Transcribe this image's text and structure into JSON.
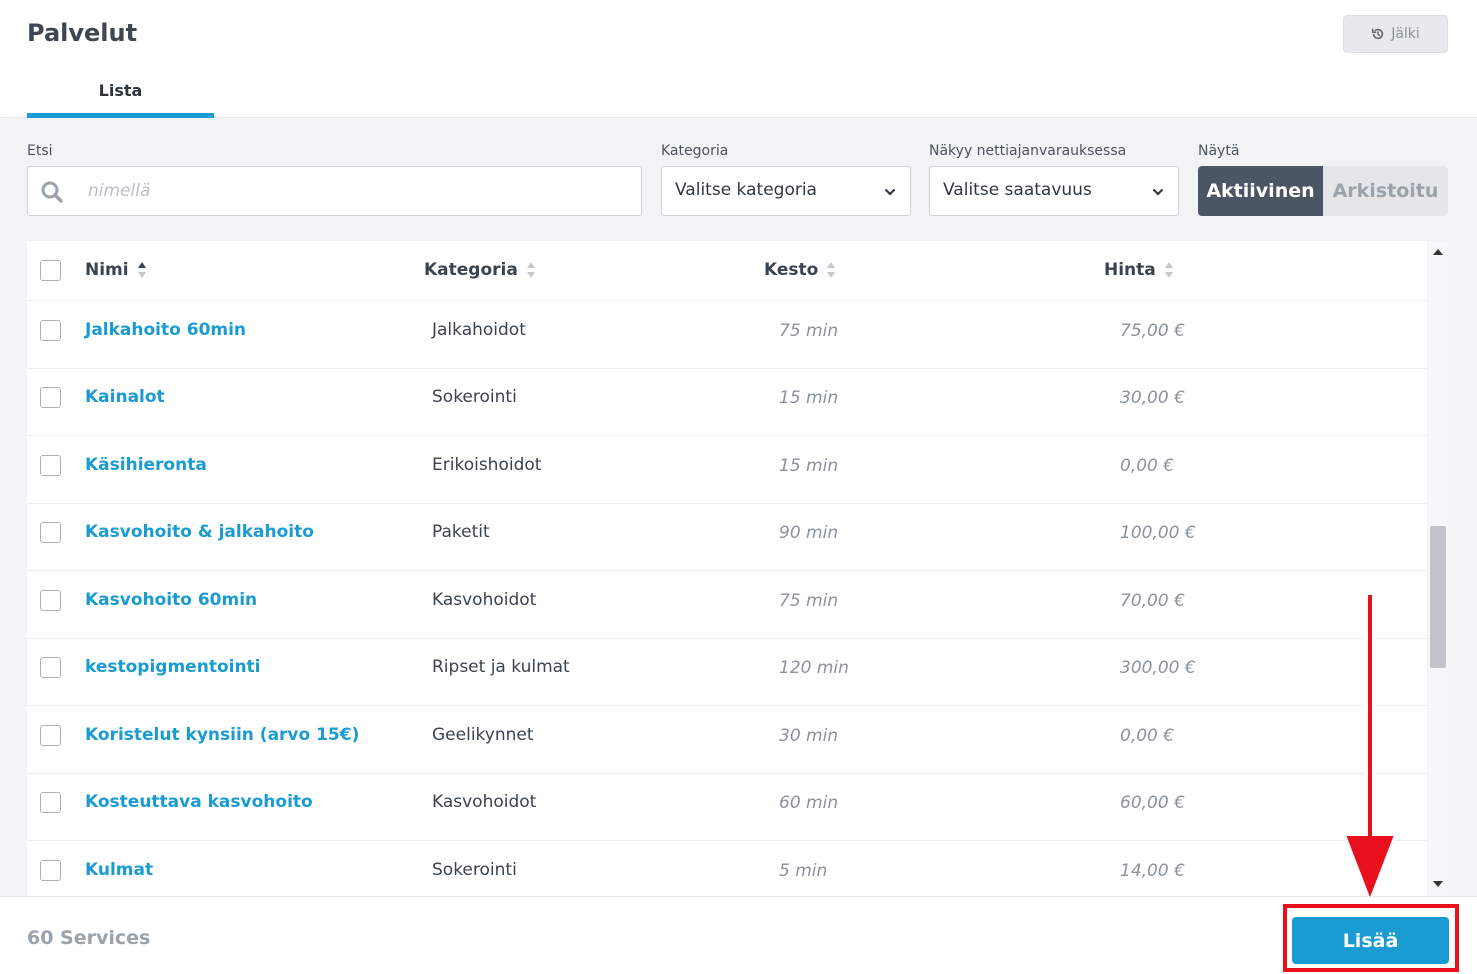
{
  "header": {
    "title": "Palvelut",
    "history_label": "Jälki",
    "tab_label": "Lista"
  },
  "filters": {
    "search_label": "Etsi",
    "search_placeholder": "nimellä",
    "category_label": "Kategoria",
    "category_value": "Valitse kategoria",
    "availability_label": "Näkyy nettiajanvarauksessa",
    "availability_value": "Valitse saatavuus",
    "show_label": "Näytä",
    "show_active": "Aktiivinen",
    "show_archived": "Arkistoitu"
  },
  "table": {
    "columns": [
      "Nimi",
      "Kategoria",
      "Kesto",
      "Hinta"
    ],
    "rows": [
      {
        "name": "Jalkahoito 60min",
        "category": "Jalkahoidot",
        "duration": "75 min",
        "price": "75,00 €"
      },
      {
        "name": "Kainalot",
        "category": "Sokerointi",
        "duration": "15 min",
        "price": "30,00 €"
      },
      {
        "name": "Käsihieronta",
        "category": "Erikoishoidot",
        "duration": "15 min",
        "price": "0,00 €"
      },
      {
        "name": "Kasvohoito & jalkahoito",
        "category": "Paketit",
        "duration": "90 min",
        "price": "100,00 €"
      },
      {
        "name": "Kasvohoito 60min",
        "category": "Kasvohoidot",
        "duration": "75 min",
        "price": "70,00 €"
      },
      {
        "name": "kestopigmentointi",
        "category": "Ripset ja kulmat",
        "duration": "120 min",
        "price": "300,00 €"
      },
      {
        "name": "Koristelut kynsiin (arvo 15€)",
        "category": "Geelikynnet",
        "duration": "30 min",
        "price": "0,00 €"
      },
      {
        "name": "Kosteuttava kasvohoito",
        "category": "Kasvohoidot",
        "duration": "60 min",
        "price": "60,00 €"
      },
      {
        "name": "Kulmat",
        "category": "Sokerointi",
        "duration": "5 min",
        "price": "14,00 €"
      }
    ]
  },
  "footer": {
    "count_label": "60 Services",
    "add_label": "Lisää"
  },
  "colors": {
    "accent": "#1a9bd1",
    "annotation": "#e8101c",
    "toggle_active": "#4b5563"
  }
}
